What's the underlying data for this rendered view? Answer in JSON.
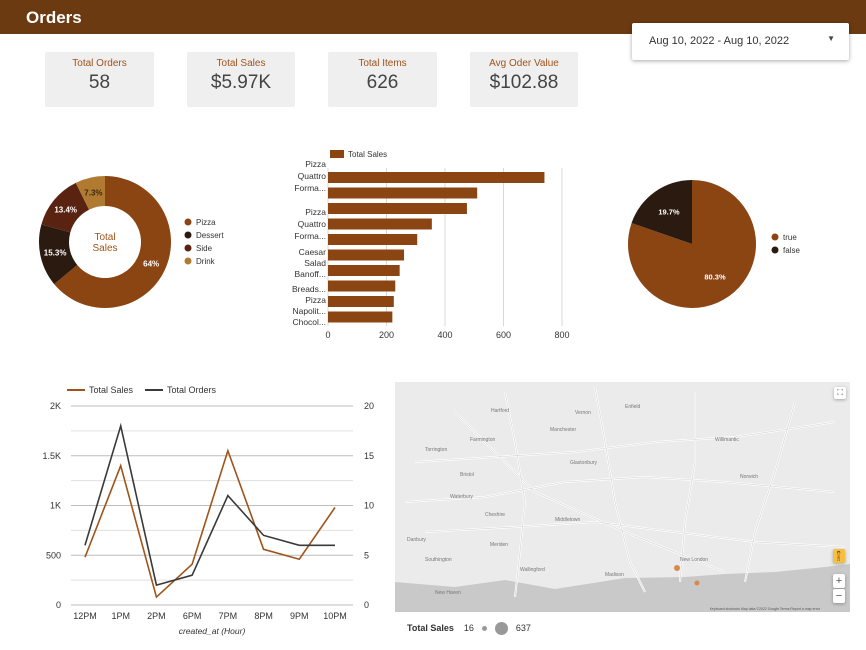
{
  "header": {
    "title": "Orders"
  },
  "date_range": {
    "label": "Aug 10, 2022 - Aug 10, 2022"
  },
  "kpis": [
    {
      "label": "Total Orders",
      "value": "58"
    },
    {
      "label": "Total Sales",
      "value": "$5.97K"
    },
    {
      "label": "Total Items",
      "value": "626"
    },
    {
      "label": "Avg Oder Value",
      "value": "$102.88"
    }
  ],
  "colors": {
    "header": "#6b3a10",
    "pizza": "#8b4513",
    "dessert": "#2b1a10",
    "side": "#5a2210",
    "drink": "#b07a30",
    "bar": "#8b4513",
    "sales_line": "#a0531a",
    "orders_line": "#3a3a3a",
    "true": "#8b4513",
    "false": "#2b1a10"
  },
  "chart_data": [
    {
      "type": "pie",
      "donut": true,
      "center_label": [
        "Total",
        "Sales"
      ],
      "labels": [
        "Pizza",
        "Dessert",
        "Side",
        "Drink"
      ],
      "values": [
        64,
        15.3,
        13.4,
        7.3
      ],
      "value_labels": [
        "64%",
        "15.3%",
        "13.4%",
        "7.3%"
      ],
      "legend": "right"
    },
    {
      "type": "bar",
      "orientation": "horizontal",
      "legend_label": "Total Sales",
      "categories": [
        "Pizza Quattro Forma...",
        "",
        "Pizza Quattro Forma...",
        "",
        "",
        "Caesar Salad",
        "Banoff...",
        "Breads...",
        "Pizza Napolit...",
        "Chocol..."
      ],
      "values": [
        740,
        510,
        475,
        355,
        305,
        260,
        245,
        230,
        225,
        220
      ],
      "xticks": [
        "0",
        "200",
        "400",
        "600",
        "800"
      ],
      "xlim": [
        0,
        800
      ],
      "grid": true
    },
    {
      "type": "pie",
      "labels": [
        "true",
        "false"
      ],
      "values": [
        80.3,
        19.7
      ],
      "value_labels": [
        "80.3%",
        "19.7%"
      ],
      "legend": "right"
    },
    {
      "type": "line",
      "x": [
        "12PM",
        "1PM",
        "2PM",
        "6PM",
        "7PM",
        "8PM",
        "9PM",
        "10PM"
      ],
      "xlabel": "created_at (Hour)",
      "series": [
        {
          "name": "Total Sales",
          "axis": "left",
          "values": [
            480,
            1400,
            80,
            410,
            1550,
            560,
            460,
            980
          ]
        },
        {
          "name": "Total Orders",
          "axis": "right",
          "values": [
            6,
            18,
            2,
            3,
            11,
            7,
            6,
            6
          ]
        }
      ],
      "y_left": {
        "ylim": [
          0,
          2000
        ],
        "ticks": [
          "0",
          "500",
          "1K",
          "1.5K",
          "2K"
        ]
      },
      "y_right": {
        "ylim": [
          0,
          20
        ],
        "ticks": [
          "0",
          "5",
          "10",
          "15",
          "20"
        ]
      },
      "legend": "top",
      "grid": true
    }
  ],
  "map": {
    "legend_title": "Total Sales",
    "legend_min": "16",
    "legend_max": "637",
    "towns": [
      "Hartford",
      "New Haven",
      "Waterbury",
      "Middletown",
      "Torrington",
      "Norwich",
      "Manchester",
      "Bristol",
      "Meriden",
      "Willimantic",
      "Danbury",
      "New London",
      "Enfield",
      "Vernon",
      "Glastonbury",
      "Farmington",
      "Southington",
      "Wallingford",
      "Cheshire",
      "Madison"
    ],
    "zoom_in": "+",
    "zoom_out": "−",
    "footer": "Keyboard shortcuts   Map data ©2022 Google   Terms   Report a map error"
  }
}
